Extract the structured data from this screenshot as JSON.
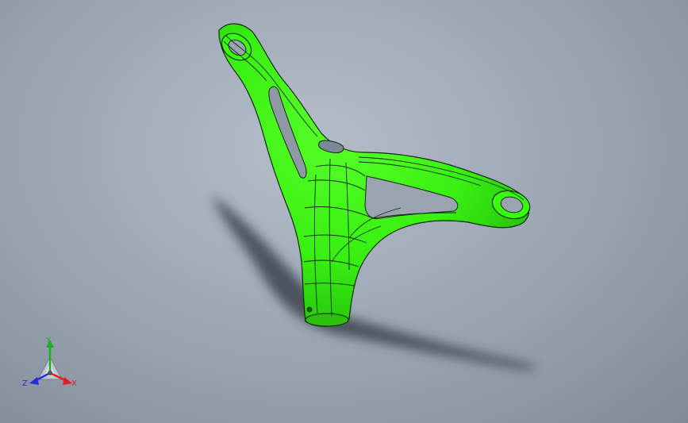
{
  "viewport": {
    "background_top": "#b4bdc8",
    "background_bottom": "#808a97"
  },
  "model": {
    "part_color": "#38ff0d",
    "edge_color": "#0b2a05",
    "shadow_color": "#2f3540"
  },
  "triad": {
    "x_label": "X",
    "y_label": "Y",
    "z_label": "Z",
    "x_color": "#e02020",
    "y_color": "#17b417",
    "z_color": "#2030d8"
  }
}
